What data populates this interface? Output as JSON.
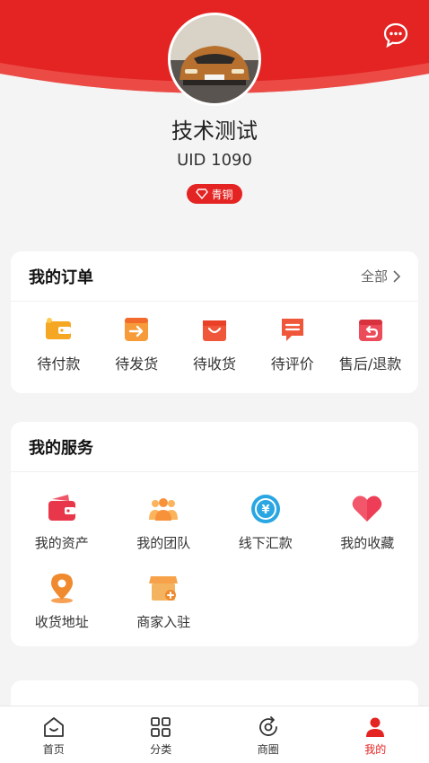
{
  "profile": {
    "avatar_alt": "sports car avatar",
    "name": "技术测试",
    "uid": "UID 1090",
    "level": "青铜"
  },
  "orders": {
    "title": "我的订单",
    "more": "全部",
    "items": [
      {
        "label": "待付款",
        "icon": "wallet-icon"
      },
      {
        "label": "待发货",
        "icon": "ship-icon"
      },
      {
        "label": "待收货",
        "icon": "bag-icon"
      },
      {
        "label": "待评价",
        "icon": "comment-icon"
      },
      {
        "label": "售后/退款",
        "icon": "refund-icon"
      }
    ]
  },
  "services": {
    "title": "我的服务",
    "items": [
      {
        "label": "我的资产",
        "icon": "assets-icon"
      },
      {
        "label": "我的团队",
        "icon": "team-icon"
      },
      {
        "label": "线下汇款",
        "icon": "remit-icon"
      },
      {
        "label": "我的收藏",
        "icon": "heart-icon"
      },
      {
        "label": "收货地址",
        "icon": "location-icon"
      },
      {
        "label": "商家入驻",
        "icon": "shop-icon"
      }
    ]
  },
  "tabbar": {
    "items": [
      {
        "label": "首页",
        "icon": "home-icon"
      },
      {
        "label": "分类",
        "icon": "category-icon"
      },
      {
        "label": "商圈",
        "icon": "circle-icon"
      },
      {
        "label": "我的",
        "icon": "user-icon"
      }
    ],
    "active_index": 3
  },
  "colors": {
    "brand_red": "#e32422",
    "background": "#f4f4f4"
  }
}
